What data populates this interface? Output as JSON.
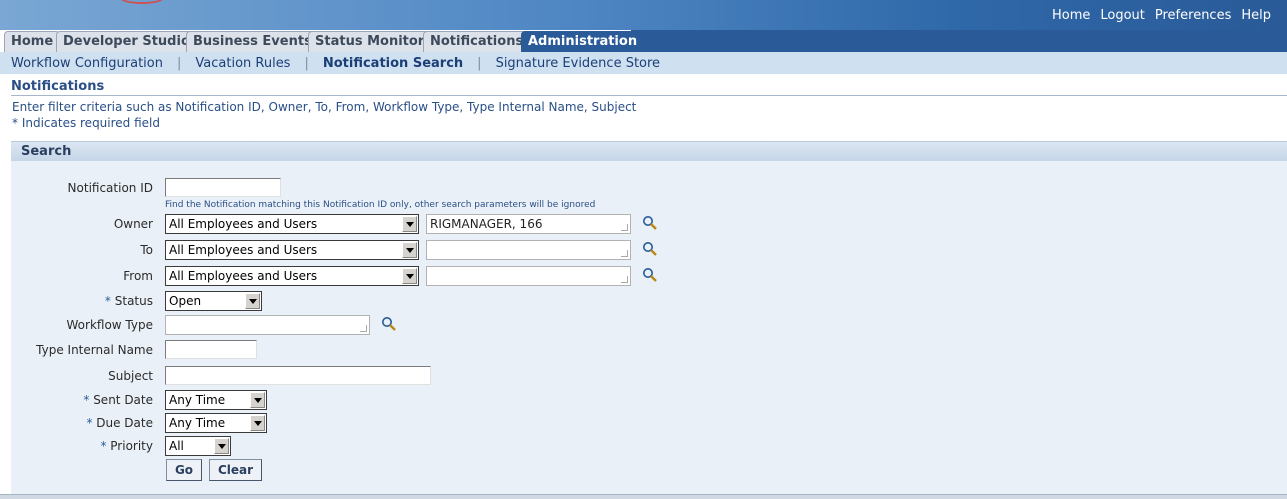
{
  "global_links": [
    "Home",
    "Logout",
    "Preferences",
    "Help"
  ],
  "tabs": [
    {
      "label": "Home"
    },
    {
      "label": "Developer Studio"
    },
    {
      "label": "Business Events"
    },
    {
      "label": "Status Monitor"
    },
    {
      "label": "Notifications"
    },
    {
      "label": "Administration"
    }
  ],
  "subtabs": [
    {
      "label": "Workflow Configuration"
    },
    {
      "label": "Vacation Rules"
    },
    {
      "label": "Notification Search"
    },
    {
      "label": "Signature Evidence Store"
    }
  ],
  "page": {
    "title": "Notifications",
    "instruction": "Enter filter criteria such as Notification ID, Owner, To, From, Workflow Type, Type Internal Name, Subject",
    "required_note": "* Indicates required field"
  },
  "search": {
    "header": "Search",
    "notification_id": {
      "label": "Notification ID",
      "value": "",
      "hint": "Find the Notification matching this Notification ID only, other search parameters will be ignored"
    },
    "owner": {
      "label": "Owner",
      "select": "All Employees and Users",
      "value": "RIGMANAGER, 166"
    },
    "to": {
      "label": "To",
      "select": "All Employees and Users",
      "value": ""
    },
    "from": {
      "label": "From",
      "select": "All Employees and Users",
      "value": ""
    },
    "status": {
      "label": "Status",
      "select": "Open"
    },
    "workflow_type": {
      "label": "Workflow Type",
      "value": ""
    },
    "type_internal_name": {
      "label": "Type Internal Name",
      "value": ""
    },
    "subject": {
      "label": "Subject",
      "value": ""
    },
    "sent_date": {
      "label": "Sent Date",
      "select": "Any Time"
    },
    "due_date": {
      "label": "Due Date",
      "select": "Any Time"
    },
    "priority": {
      "label": "Priority",
      "select": "All"
    },
    "go_label": "Go",
    "clear_label": "Clear",
    "required_star": "*"
  },
  "colors": {
    "accent": "#2a5a98",
    "subtab_bg": "#cfe0f0",
    "region_bg": "#eaf0f7"
  },
  "icons": [
    "search-icon"
  ]
}
